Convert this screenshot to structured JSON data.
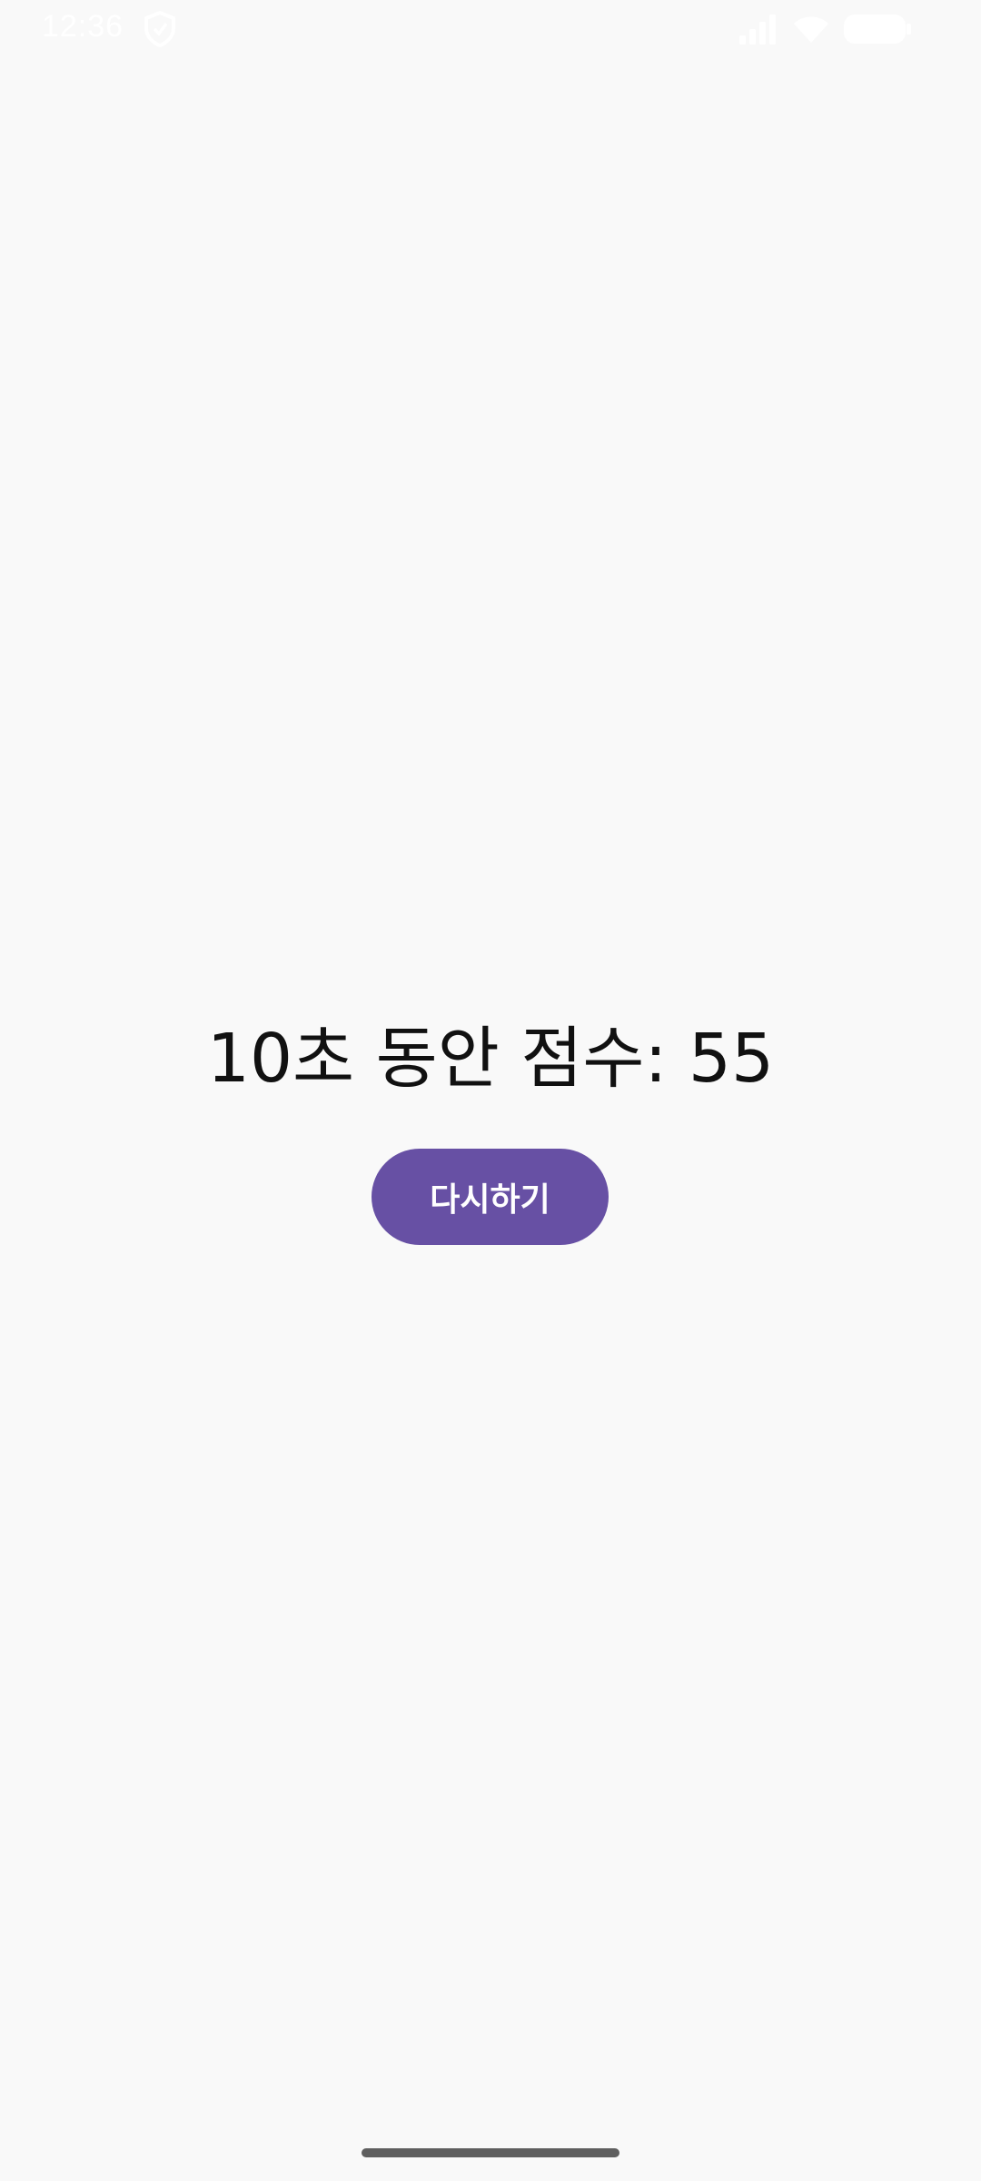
{
  "status_bar": {
    "time": "12:36",
    "icons": [
      "shield-icon",
      "signal-icon",
      "wifi-icon",
      "battery-icon"
    ],
    "icon_color": "#ffffff"
  },
  "main": {
    "score_text": "10초 동안 점수: 55",
    "retry_label": "다시하기"
  },
  "colors": {
    "background": "#f9f9f9",
    "accent": "#6750a4",
    "text": "#111111"
  }
}
